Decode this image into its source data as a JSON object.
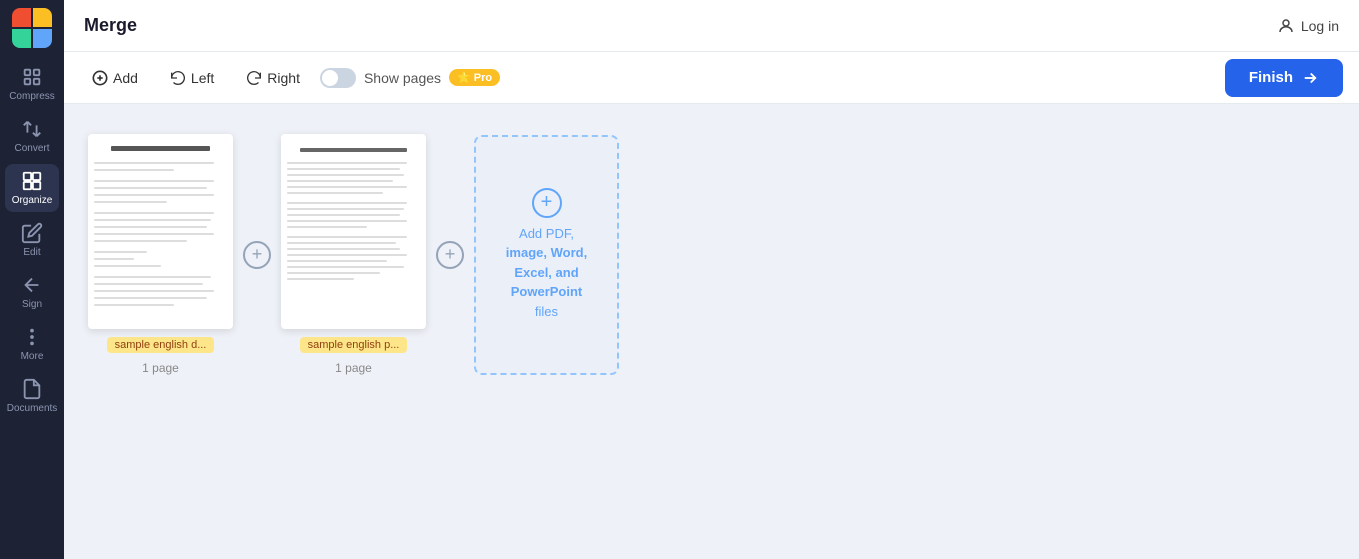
{
  "app": {
    "title": "Merge",
    "logo_colors": [
      "#f04e30",
      "#fbbf24",
      "#34d399",
      "#60a5fa"
    ]
  },
  "header": {
    "title": "Merge",
    "login_label": "Log in"
  },
  "toolbar": {
    "add_label": "Add",
    "left_label": "Left",
    "right_label": "Right",
    "show_pages_label": "Show pages",
    "finish_label": "Finish",
    "pro_badge": "Pro"
  },
  "sidebar": {
    "items": [
      {
        "id": "compress",
        "label": "Compress",
        "icon": "compress-icon"
      },
      {
        "id": "convert",
        "label": "Convert",
        "icon": "convert-icon"
      },
      {
        "id": "organize",
        "label": "Organize",
        "icon": "organize-icon",
        "active": true
      },
      {
        "id": "edit",
        "label": "Edit",
        "icon": "edit-icon"
      },
      {
        "id": "sign",
        "label": "Sign",
        "icon": "sign-icon"
      },
      {
        "id": "more",
        "label": "More",
        "icon": "more-icon"
      },
      {
        "id": "documents",
        "label": "Documents",
        "icon": "documents-icon"
      }
    ]
  },
  "documents": [
    {
      "id": "doc1",
      "label": "sample english d...",
      "pages": "1 page",
      "label_color": "yellow"
    },
    {
      "id": "doc2",
      "label": "sample english p...",
      "pages": "1 page",
      "label_color": "yellow"
    }
  ],
  "dropzone": {
    "text_line1": "Add PDF,",
    "text_line2": "image, Word,",
    "text_line3": "Excel, and",
    "text_line4": "PowerPoint",
    "text_line5": "files"
  }
}
